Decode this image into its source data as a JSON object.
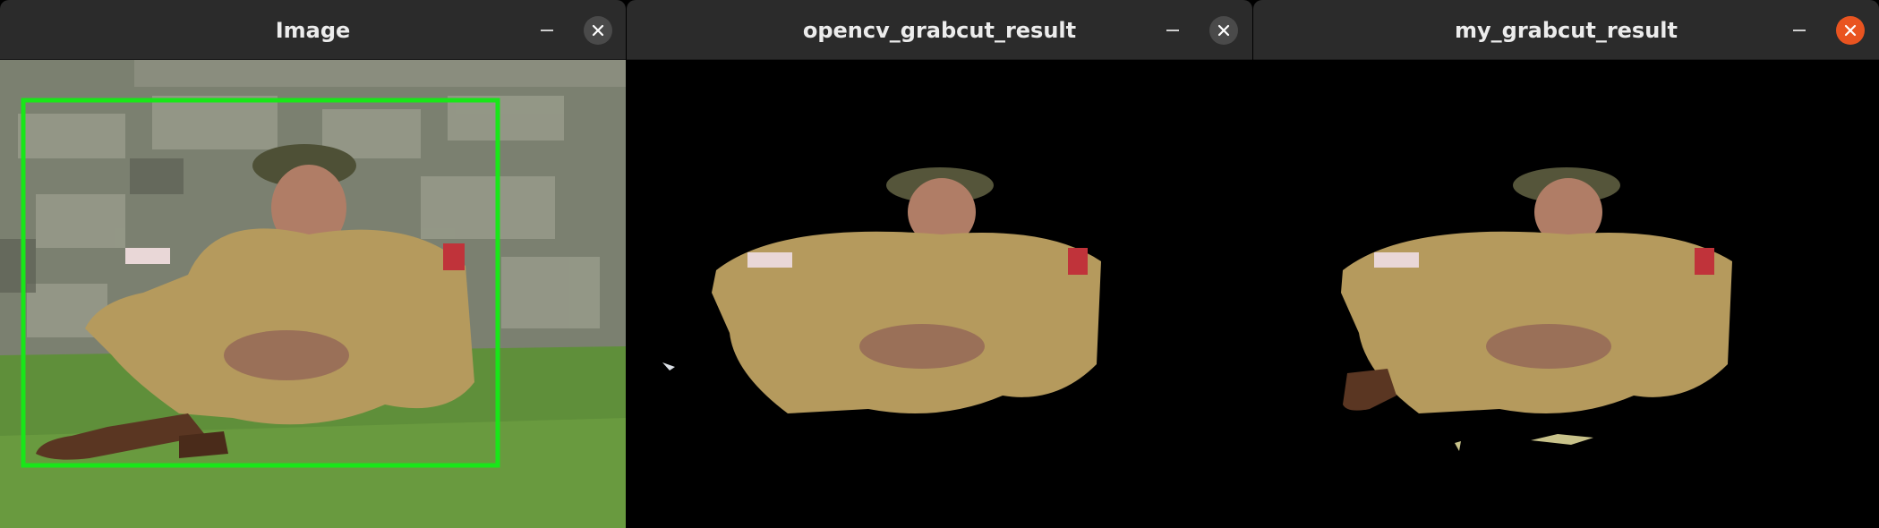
{
  "windows": [
    {
      "title": "Image",
      "minimize_icon": "minimize-icon",
      "close_icon": "close-icon",
      "close_active": false,
      "content": "original-photo-with-bounding-box",
      "colors": {
        "box": "#19e619"
      }
    },
    {
      "title": "opencv_grabcut_result",
      "minimize_icon": "minimize-icon",
      "close_icon": "close-icon",
      "close_active": false,
      "content": "segmented-foreground"
    },
    {
      "title": "my_grabcut_result",
      "minimize_icon": "minimize-icon",
      "close_icon": "close-icon",
      "close_active": true,
      "content": "segmented-foreground"
    }
  ],
  "colors": {
    "titlebar": "#2b2b2b",
    "title_text": "#ececec",
    "close_inactive": "#4a4a4a",
    "close_active": "#e95420",
    "canvas": "#000000"
  }
}
